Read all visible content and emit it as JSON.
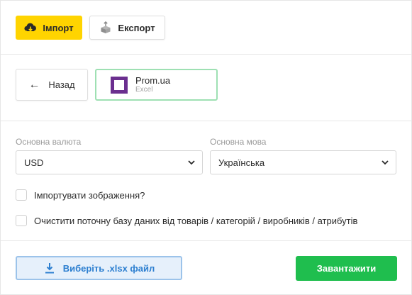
{
  "toolbar": {
    "import_label": "Імпорт",
    "export_label": "Експорт",
    "import_icon": "cloud-download-icon",
    "export_icon": "box-upload-icon",
    "accent_color": "#ffd400"
  },
  "source": {
    "back_label": "Назад",
    "name": "Prom.ua",
    "type": "Excel",
    "logo_color": "#6b2f8f"
  },
  "form": {
    "currency_label": "Основна валюта",
    "currency_value": "USD",
    "language_label": "Основна мова",
    "language_value": "Українська",
    "import_images_label": "Імпортувати зображення?",
    "import_images_checked": false,
    "clear_db_label": "Очистити поточну базу даних від товарів / категорій / виробників / атрибутів",
    "clear_db_checked": false
  },
  "footer": {
    "choose_file_label": "Виберіть .xlsx файл",
    "upload_label": "Завантажити",
    "upload_color": "#1fbe4e",
    "file_color": "#2d7fd0"
  }
}
